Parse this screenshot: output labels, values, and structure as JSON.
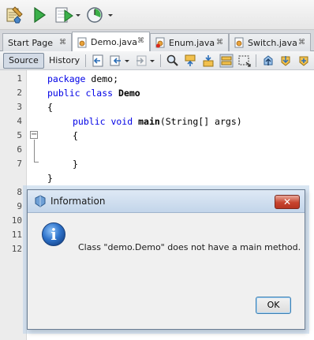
{
  "tabs": [
    {
      "label": "Start Page",
      "close": "⌘"
    },
    {
      "label": "Demo.java",
      "close": "⌘"
    },
    {
      "label": "Enum.java",
      "close": "⌘"
    },
    {
      "label": "Switch.java",
      "close": "⌘"
    }
  ],
  "editor_toolbar": {
    "source_label": "Source",
    "history_label": "History"
  },
  "code": {
    "line_numbers": [
      "1",
      "2",
      "3",
      "4",
      "5",
      "6",
      "7",
      "8",
      "9",
      "10",
      "11",
      "12"
    ],
    "line1_kw": "package",
    "line1_rest": " demo;",
    "line2_kw": "public class",
    "line2_name": "Demo",
    "line3": "{",
    "line4_kw": "public void",
    "line4_name": "main",
    "line4_rest": "(String[] args)",
    "line5": "{",
    "line7": "}",
    "line8": "}",
    "fold_minus": "−"
  },
  "dialog": {
    "title": "Information",
    "close_label": "✕",
    "message": "Class \"demo.Demo\" does not have a main method.",
    "ok_label": "OK",
    "info_glyph": "i"
  },
  "colors": {
    "keyword": "#0000e6",
    "current_line": "#e9eff8",
    "dialog_title_bg": "#c3d5ea",
    "close_button_red": "#c7442e"
  }
}
